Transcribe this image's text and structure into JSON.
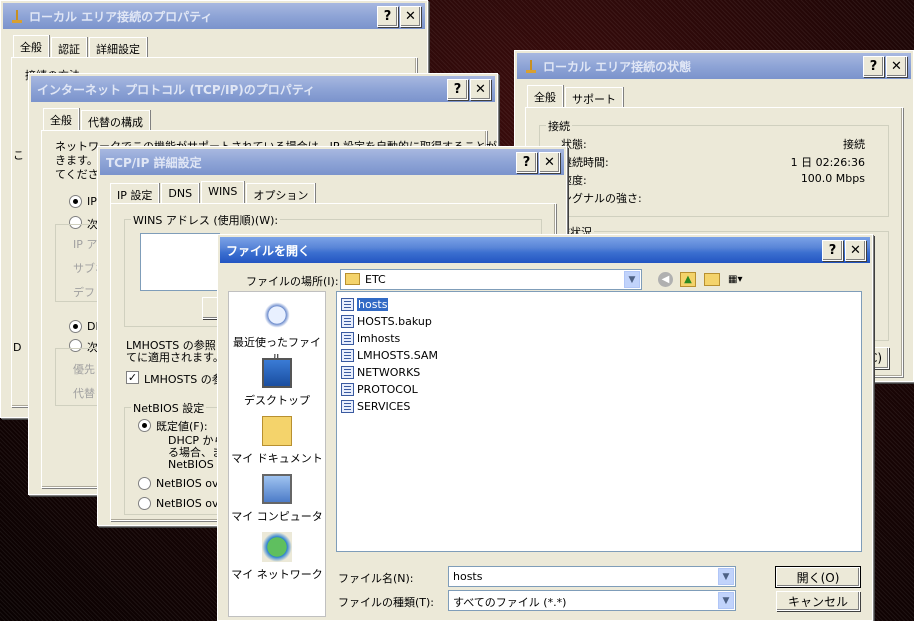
{
  "win_props": {
    "title": "ローカル エリア接続のプロパティ",
    "tabs": [
      "全般",
      "認証",
      "詳細設定"
    ],
    "partial_text": [
      "接続の方法",
      "こ",
      "D"
    ]
  },
  "win_tcpip": {
    "title": "インターネット プロトコル (TCP/IP)のプロパティ",
    "tabs": [
      "全般",
      "代替の構成"
    ],
    "intro_lines": [
      "ネットワークでこの機能がサポートされている場合は、IP 設定を自動的に取得することがで",
      "きます。サ",
      "てください"
    ],
    "radio_auto": "IP",
    "radio_manual": "次",
    "field_ip": "IP ア",
    "field_subnet": "サブネ",
    "field_gateway": "デフォ",
    "radio_dns_auto": "DN",
    "radio_dns_manual": "次",
    "field_dns1": "優先",
    "field_dns2": "代替"
  },
  "win_status": {
    "title": "ローカル エリア接続の状態",
    "tabs": [
      "全般",
      "サポート"
    ],
    "group_title": "接続",
    "rows": [
      {
        "label": "状態:",
        "value": "接続"
      },
      {
        "label": "継続時間:",
        "value": "1 日 02:26:36"
      },
      {
        "label": "速度:",
        "value": "100.0 Mbps"
      },
      {
        "label": "シグナルの強さ:",
        "value": ""
      }
    ],
    "group2_title": "動作状況",
    "partial_btn": "C)"
  },
  "win_advanced": {
    "title": "TCP/IP 詳細設定",
    "tabs": [
      "IP 設定",
      "DNS",
      "WINS",
      "オプション"
    ],
    "wins_label": "WINS アドレス (使用順)(W):",
    "lmhosts_text_1": "LMHOSTS の参照",
    "lmhosts_text_2": "てに適用されます。",
    "lmhosts_check": "LMHOSTS の参",
    "netbios_group": "NetBIOS 設定",
    "netbios_default": "既定値(F):",
    "netbios_desc_1": "DHCP から",
    "netbios_desc_2": "る場合、ま",
    "netbios_desc_3": "NetBIOS の",
    "netbios_enable": "NetBIOS ove",
    "netbios_disable": "NetBIOS ove"
  },
  "win_open": {
    "title": "ファイルを開く",
    "location_label": "ファイルの場所(I):",
    "location_value": "ETC",
    "places": [
      {
        "label": "最近使ったファイル",
        "icon": "recent-icon"
      },
      {
        "label": "デスクトップ",
        "icon": "desktop-icon"
      },
      {
        "label": "マイ ドキュメント",
        "icon": "my-documents-icon"
      },
      {
        "label": "マイ コンピュータ",
        "icon": "my-computer-icon"
      },
      {
        "label": "マイ ネットワーク",
        "icon": "my-network-icon"
      }
    ],
    "files": [
      "hosts",
      "HOSTS.bakup",
      "lmhosts",
      "LMHOSTS.SAM",
      "NETWORKS",
      "PROTOCOL",
      "SERVICES"
    ],
    "selected_file": "hosts",
    "filename_label": "ファイル名(N):",
    "filename_value": "hosts",
    "filetype_label": "ファイルの種類(T):",
    "filetype_value": "すべてのファイル (*.*)",
    "open_button": "開く(O)",
    "cancel_button": "キャンセル"
  }
}
